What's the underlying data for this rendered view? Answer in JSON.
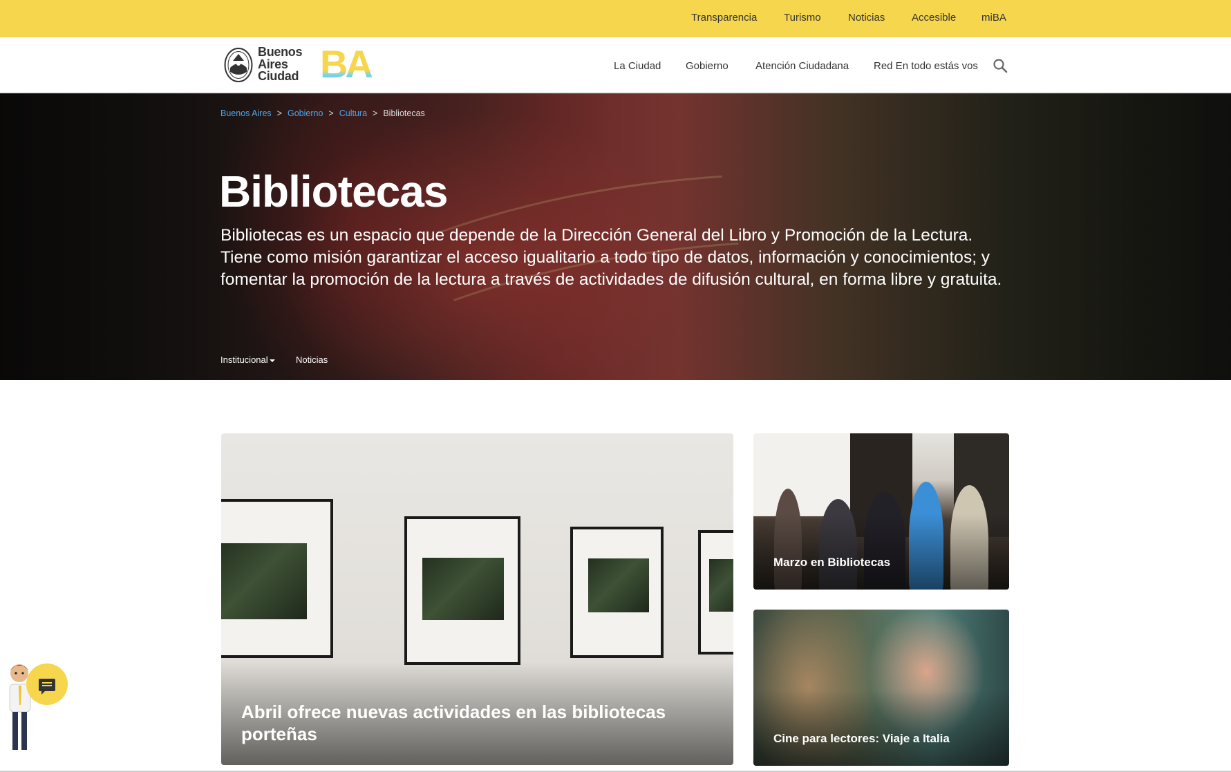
{
  "topbar": {
    "links": [
      "Transparencia",
      "Turismo",
      "Noticias",
      "Accesible",
      "miBA"
    ]
  },
  "header": {
    "logo_text": [
      "Buenos",
      "Aires",
      "Ciudad"
    ],
    "brand": "BA",
    "nav": [
      "La Ciudad",
      "Gobierno",
      "Atención Ciudadana",
      "Red En todo estás vos"
    ],
    "search_icon": "search-icon"
  },
  "hero": {
    "breadcrumb": [
      "Buenos Aires",
      "Gobierno",
      "Cultura"
    ],
    "breadcrumb_sep": ">",
    "breadcrumb_current": "Bibliotecas",
    "title": "Bibliotecas",
    "description": "Bibliotecas es un espacio que depende de la Dirección General del Libro y Promoción de la Lectura. Tiene como misión garantizar el acceso igualitario a todo tipo de datos, información y conocimientos; y fomentar la promoción de la lectura a través de actividades de difusión cultural, en forma libre y gratuita.",
    "tabs": [
      "Institucional",
      "Noticias"
    ]
  },
  "cards": {
    "featured": "Abril ofrece nuevas actividades en las bibliotecas porteñas",
    "side": [
      "Marzo en Bibliotecas",
      "Cine para lectores: Viaje a Italia"
    ]
  },
  "colors": {
    "brand_yellow": "#f6d64d",
    "link_blue": "#4aa8f0",
    "text_dark": "#333333"
  },
  "chat": {
    "icon": "chat-icon"
  }
}
